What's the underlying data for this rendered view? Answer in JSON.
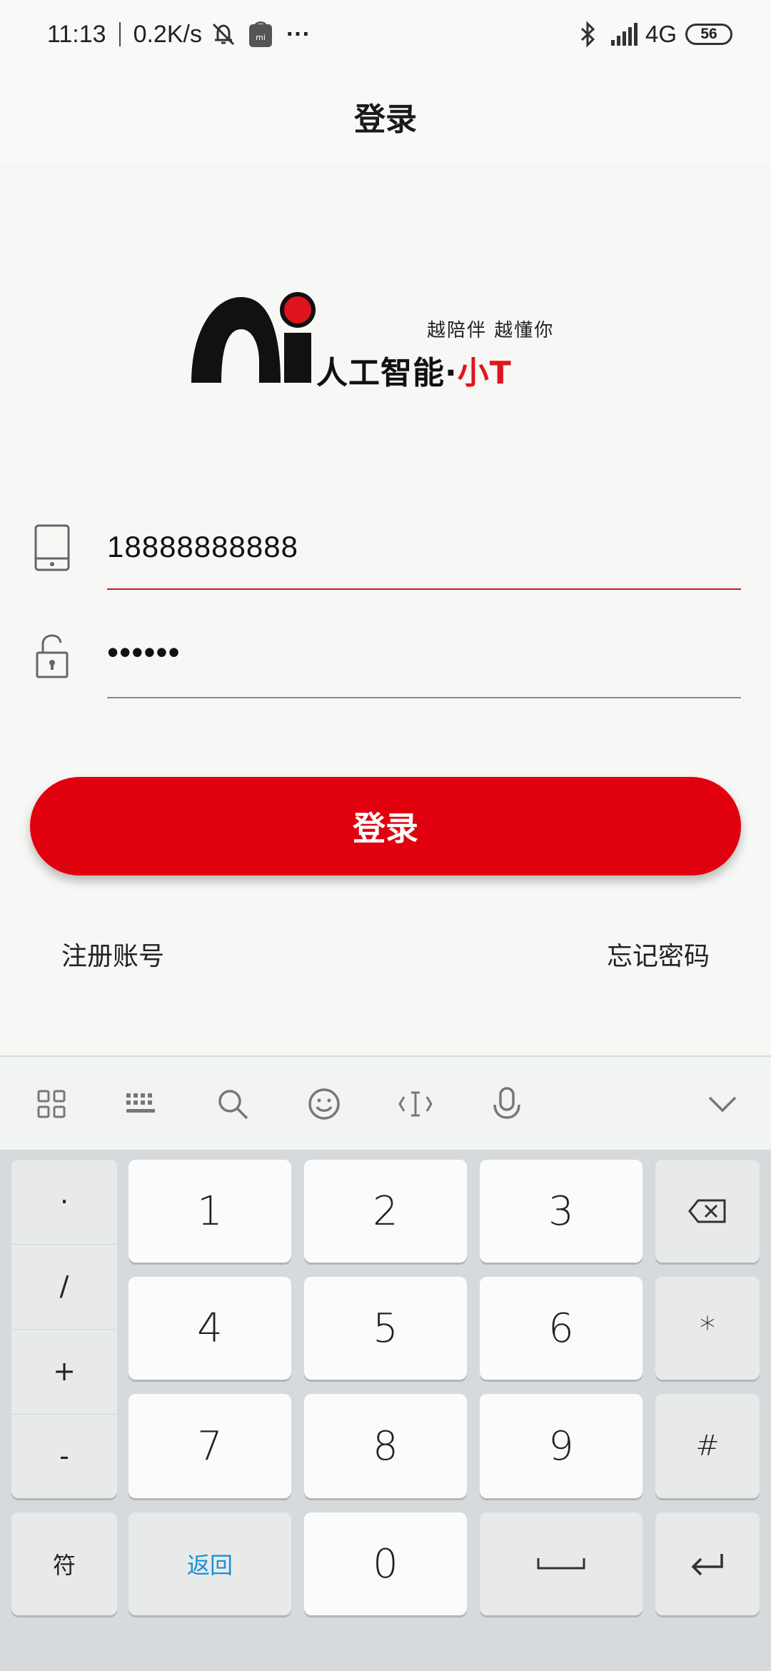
{
  "status_bar": {
    "time": "11:13",
    "speed": "0.2K/s",
    "more": "···",
    "network": "4G",
    "battery": "56"
  },
  "header": {
    "title": "登录"
  },
  "logo": {
    "mark": "Ai",
    "brand": "人工智能",
    "dot": "·",
    "brand_red": "小T",
    "slogan": "越陪伴 越懂你",
    "colors": {
      "red": "#e0141e",
      "black": "#111111"
    }
  },
  "form": {
    "phone": {
      "value": "18888888888",
      "icon": "phone-icon"
    },
    "password": {
      "value": "••••••",
      "icon": "unlock-icon"
    },
    "login_button": "登录",
    "register_link": "注册账号",
    "forgot_link": "忘记密码"
  },
  "keyboard": {
    "toolbar": [
      "grid-icon",
      "keyboard-icon",
      "search-icon",
      "emoji-icon",
      "cursor-icon",
      "microphone-icon",
      "chevron-down-icon"
    ],
    "symbols": [
      "·",
      "/",
      "+",
      "-"
    ],
    "digits": [
      "1",
      "2",
      "3",
      "4",
      "5",
      "6",
      "7",
      "8",
      "9",
      "0"
    ],
    "right_keys": [
      "backspace-icon",
      "*",
      "#",
      "enter-icon"
    ],
    "bottom": {
      "fu": "符",
      "back": "返回",
      "space": "space-icon"
    }
  },
  "colors": {
    "accent": "#e1000e",
    "link_blue": "#1a8fd8",
    "keyboard_bg": "#d6dadc"
  }
}
